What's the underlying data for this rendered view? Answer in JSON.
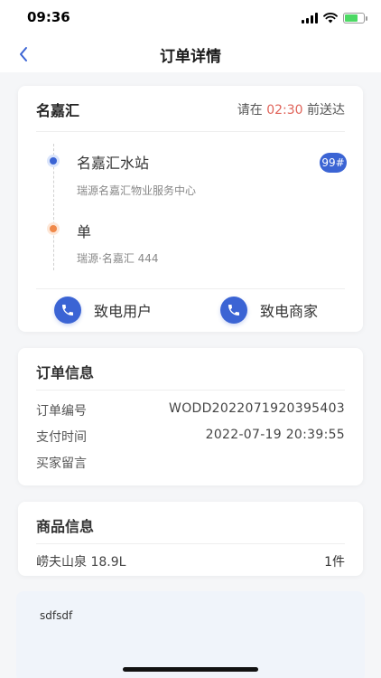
{
  "status_bar": {
    "time": "09:36"
  },
  "header": {
    "title": "订单详情",
    "back_icon": "chevron-left-icon"
  },
  "delivery": {
    "store_name": "名嘉汇",
    "deadline_prefix": "请在 ",
    "deadline_time": "02:30",
    "deadline_suffix": " 前送达",
    "pickup": {
      "title": "名嘉汇水站",
      "subtitle": "瑞源名嘉汇物业服务中心",
      "badge": "99#"
    },
    "dropoff": {
      "title": "单",
      "subtitle": "瑞源·名嘉汇 444"
    },
    "call_user_label": "致电用户",
    "call_merchant_label": "致电商家"
  },
  "order_info": {
    "title": "订单信息",
    "rows": [
      {
        "label": "订单编号",
        "value": "WODD2022071920395403"
      },
      {
        "label": "支付时间",
        "value": "2022-07-19 20:39:55"
      },
      {
        "label": "买家留言",
        "value": ""
      }
    ]
  },
  "goods_info": {
    "title": "商品信息",
    "items": [
      {
        "name": "崂夫山泉 18.9L",
        "quantity": "1件"
      }
    ]
  },
  "note": {
    "text": "sdfsdf"
  },
  "colors": {
    "accent": "#3b64d4",
    "highlight": "#e0645a",
    "pickup_dot": "#3b64d4",
    "dropoff_dot": "#f0894a"
  }
}
